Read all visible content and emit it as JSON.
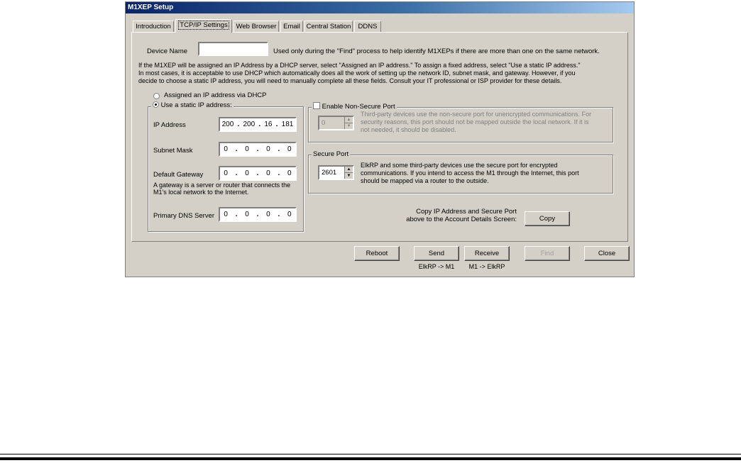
{
  "window": {
    "title": "M1XEP Setup"
  },
  "tabs": [
    {
      "label": "Introduction"
    },
    {
      "label": "TCP/IP Settings"
    },
    {
      "label": "Web Browser"
    },
    {
      "label": "Email"
    },
    {
      "label": "Central Station"
    },
    {
      "label": "DDNS"
    }
  ],
  "device": {
    "label": "Device Name",
    "value": "",
    "note": "Used only during the \"Find\" process to help identify M1XEPs if there are more than one on the same network."
  },
  "intro_lines": [
    "If the M1XEP will be assigned an IP Address by a DHCP server, select \"Assigned an IP address.\"  To assign a fixed address, select \"Use a static IP address.\"",
    "In most cases, it is acceptable to use DHCP which automatically does all the work of setting up the network ID, subnet mask, and gateway.  However, if you",
    "decide to choose a static IP address, you will need to manually complete all these fields.  Consult your IT professional or ISP provider for these details."
  ],
  "dhcp": {
    "label": "Assigned an IP address via DHCP",
    "selected": false
  },
  "static": {
    "label": "Use a static IP address:",
    "selected": true,
    "ip_label": "IP Address",
    "ip": [
      "200",
      "200",
      "16",
      "181"
    ],
    "subnet_label": "Subnet Mask",
    "subnet": [
      "0",
      "0",
      "0",
      "0"
    ],
    "gateway_label": "Default Gateway",
    "gateway": [
      "0",
      "0",
      "0",
      "0"
    ],
    "gateway_note_1": "A gateway is a server or router that connects the",
    "gateway_note_2": "M1's local network to the Internet.",
    "dns_label": "Primary DNS Server",
    "dns": [
      "0",
      "0",
      "0",
      "0"
    ]
  },
  "nonsecure": {
    "label": "Enable Non-Secure Port",
    "checked": false,
    "port": "0",
    "desc_1": "Third-party devices use the non-secure port for unencrypted communications. For",
    "desc_2": "security reasons, this port should not be mapped outside the local network. If it is",
    "desc_3": "not needed, it should be disabled."
  },
  "secure": {
    "label": "Secure Port",
    "port": "2601",
    "desc_1": "ElkRP and some third-party devices use the secure port for encrypted",
    "desc_2": "communications. If you intend to access the M1 through the Internet, this port",
    "desc_3": "should be mapped via a router to the outside."
  },
  "copy": {
    "text_1": "Copy IP Address and Secure Port",
    "text_2": "above to the Account Details Screen:",
    "button": "Copy"
  },
  "buttons": {
    "reboot": "Reboot",
    "send": "Send",
    "send_caption": "ElkRP -> M1",
    "receive": "Receive",
    "receive_caption": "M1 -> ElkRP",
    "find": "Find",
    "close": "Close"
  }
}
